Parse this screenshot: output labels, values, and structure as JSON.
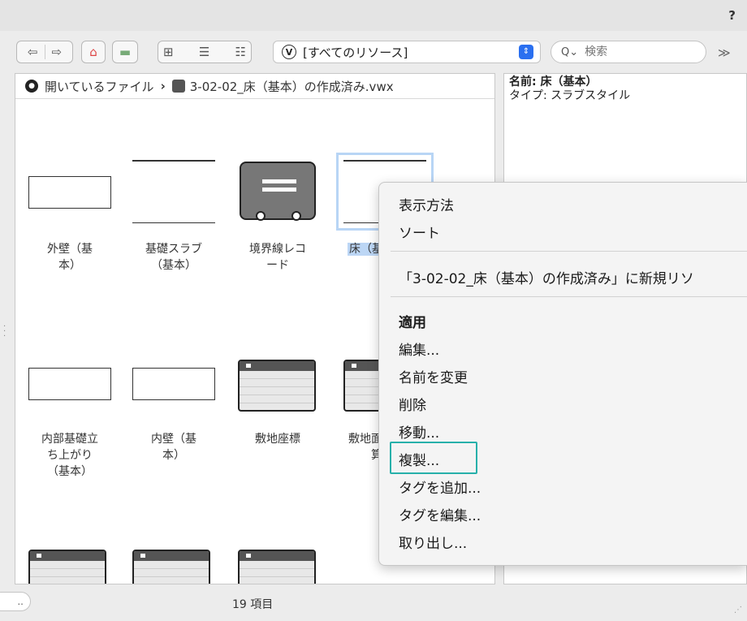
{
  "help_label": "?",
  "toolbar": {
    "filter_value": "[すべてのリソース]",
    "search_placeholder": "検索",
    "more": "≫"
  },
  "breadcrumb": {
    "root": "開いているファイル",
    "separator": "›",
    "file": "3-02-02_床（基本）の作成済み.vwx"
  },
  "resources": [
    {
      "label": "外壁（基\n本）"
    },
    {
      "label": "基礎スラブ\n（基本）"
    },
    {
      "label": "境界線レコ\nード"
    },
    {
      "label": "床（基"
    },
    {
      "label": "内部基礎立\nち上がり\n（基本）"
    },
    {
      "label": "内壁（基\n本）"
    },
    {
      "label": "敷地座標"
    },
    {
      "label": "敷地面\n算"
    }
  ],
  "info": {
    "name_label": "名前: ",
    "name_value": "床（基本）",
    "type_line": "タイプ: スラブスタイル"
  },
  "status": {
    "count": "19 項目",
    "button": ".."
  },
  "context_menu": {
    "items": [
      "表示方法",
      "ソート",
      "「3-02-02_床（基本）の作成済み」に新規リソ",
      "適用",
      "編集...",
      "名前を変更",
      "削除",
      "移動...",
      "複製...",
      "タグを追加...",
      "タグを編集...",
      "取り出し..."
    ]
  },
  "colors": {
    "highlight": "#27b0aa",
    "selection": "#bcd6f5",
    "accent": "#2a6ff0"
  }
}
